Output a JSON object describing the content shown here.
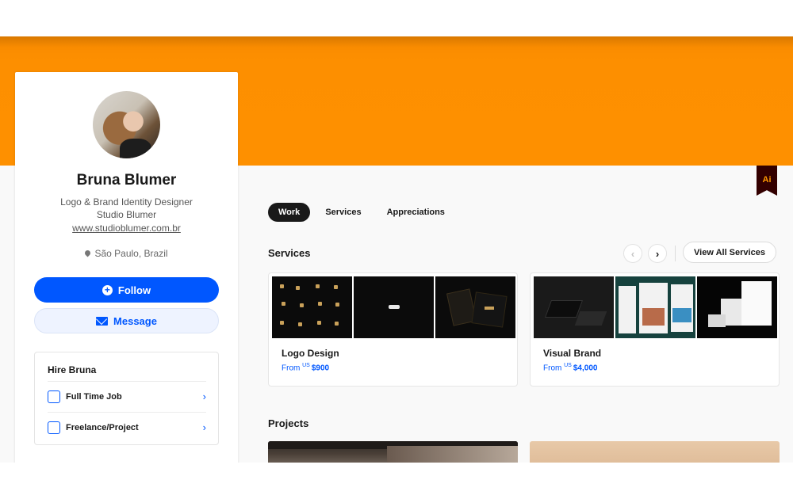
{
  "profile": {
    "name": "Bruna Blumer",
    "role": "Logo & Brand Identity Designer",
    "company": "Studio Blumer",
    "website": "www.studioblumer.com.br",
    "location": "São Paulo, Brazil",
    "follow_label": "Follow",
    "message_label": "Message"
  },
  "hire": {
    "title": "Hire Bruna",
    "options": [
      {
        "label": "Full Time Job",
        "icon": "pen-document-icon"
      },
      {
        "label": "Freelance/Project",
        "icon": "clipboard-clock-icon"
      }
    ]
  },
  "badge": {
    "label": "Ai"
  },
  "tabs": [
    {
      "label": "Work",
      "active": true
    },
    {
      "label": "Services",
      "active": false
    },
    {
      "label": "Appreciations",
      "active": false
    }
  ],
  "services": {
    "title": "Services",
    "view_all_label": "View All Services",
    "prev_icon": "‹",
    "next_icon": "›",
    "items": [
      {
        "name": "Logo Design",
        "price_prefix": "From",
        "currency": "US",
        "price": "$900"
      },
      {
        "name": "Visual Brand",
        "price_prefix": "From",
        "currency": "US",
        "price": "$4,000"
      }
    ]
  },
  "projects": {
    "title": "Projects"
  },
  "colors": {
    "banner": "#fe9000",
    "accent": "#0057ff",
    "badge_bg": "#330000",
    "badge_text": "#ff9a00"
  }
}
